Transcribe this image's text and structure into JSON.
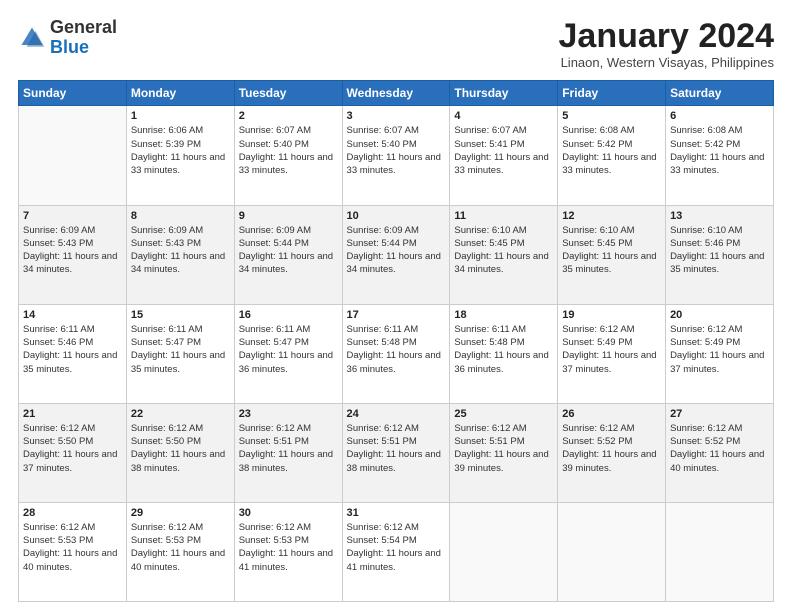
{
  "header": {
    "logo_general": "General",
    "logo_blue": "Blue",
    "month_title": "January 2024",
    "location": "Linaon, Western Visayas, Philippines"
  },
  "weekdays": [
    "Sunday",
    "Monday",
    "Tuesday",
    "Wednesday",
    "Thursday",
    "Friday",
    "Saturday"
  ],
  "weeks": [
    [
      {
        "day": "",
        "sunrise": "",
        "sunset": "",
        "daylight": ""
      },
      {
        "day": "1",
        "sunrise": "Sunrise: 6:06 AM",
        "sunset": "Sunset: 5:39 PM",
        "daylight": "Daylight: 11 hours and 33 minutes."
      },
      {
        "day": "2",
        "sunrise": "Sunrise: 6:07 AM",
        "sunset": "Sunset: 5:40 PM",
        "daylight": "Daylight: 11 hours and 33 minutes."
      },
      {
        "day": "3",
        "sunrise": "Sunrise: 6:07 AM",
        "sunset": "Sunset: 5:40 PM",
        "daylight": "Daylight: 11 hours and 33 minutes."
      },
      {
        "day": "4",
        "sunrise": "Sunrise: 6:07 AM",
        "sunset": "Sunset: 5:41 PM",
        "daylight": "Daylight: 11 hours and 33 minutes."
      },
      {
        "day": "5",
        "sunrise": "Sunrise: 6:08 AM",
        "sunset": "Sunset: 5:42 PM",
        "daylight": "Daylight: 11 hours and 33 minutes."
      },
      {
        "day": "6",
        "sunrise": "Sunrise: 6:08 AM",
        "sunset": "Sunset: 5:42 PM",
        "daylight": "Daylight: 11 hours and 33 minutes."
      }
    ],
    [
      {
        "day": "7",
        "sunrise": "Sunrise: 6:09 AM",
        "sunset": "Sunset: 5:43 PM",
        "daylight": "Daylight: 11 hours and 34 minutes."
      },
      {
        "day": "8",
        "sunrise": "Sunrise: 6:09 AM",
        "sunset": "Sunset: 5:43 PM",
        "daylight": "Daylight: 11 hours and 34 minutes."
      },
      {
        "day": "9",
        "sunrise": "Sunrise: 6:09 AM",
        "sunset": "Sunset: 5:44 PM",
        "daylight": "Daylight: 11 hours and 34 minutes."
      },
      {
        "day": "10",
        "sunrise": "Sunrise: 6:09 AM",
        "sunset": "Sunset: 5:44 PM",
        "daylight": "Daylight: 11 hours and 34 minutes."
      },
      {
        "day": "11",
        "sunrise": "Sunrise: 6:10 AM",
        "sunset": "Sunset: 5:45 PM",
        "daylight": "Daylight: 11 hours and 34 minutes."
      },
      {
        "day": "12",
        "sunrise": "Sunrise: 6:10 AM",
        "sunset": "Sunset: 5:45 PM",
        "daylight": "Daylight: 11 hours and 35 minutes."
      },
      {
        "day": "13",
        "sunrise": "Sunrise: 6:10 AM",
        "sunset": "Sunset: 5:46 PM",
        "daylight": "Daylight: 11 hours and 35 minutes."
      }
    ],
    [
      {
        "day": "14",
        "sunrise": "Sunrise: 6:11 AM",
        "sunset": "Sunset: 5:46 PM",
        "daylight": "Daylight: 11 hours and 35 minutes."
      },
      {
        "day": "15",
        "sunrise": "Sunrise: 6:11 AM",
        "sunset": "Sunset: 5:47 PM",
        "daylight": "Daylight: 11 hours and 35 minutes."
      },
      {
        "day": "16",
        "sunrise": "Sunrise: 6:11 AM",
        "sunset": "Sunset: 5:47 PM",
        "daylight": "Daylight: 11 hours and 36 minutes."
      },
      {
        "day": "17",
        "sunrise": "Sunrise: 6:11 AM",
        "sunset": "Sunset: 5:48 PM",
        "daylight": "Daylight: 11 hours and 36 minutes."
      },
      {
        "day": "18",
        "sunrise": "Sunrise: 6:11 AM",
        "sunset": "Sunset: 5:48 PM",
        "daylight": "Daylight: 11 hours and 36 minutes."
      },
      {
        "day": "19",
        "sunrise": "Sunrise: 6:12 AM",
        "sunset": "Sunset: 5:49 PM",
        "daylight": "Daylight: 11 hours and 37 minutes."
      },
      {
        "day": "20",
        "sunrise": "Sunrise: 6:12 AM",
        "sunset": "Sunset: 5:49 PM",
        "daylight": "Daylight: 11 hours and 37 minutes."
      }
    ],
    [
      {
        "day": "21",
        "sunrise": "Sunrise: 6:12 AM",
        "sunset": "Sunset: 5:50 PM",
        "daylight": "Daylight: 11 hours and 37 minutes."
      },
      {
        "day": "22",
        "sunrise": "Sunrise: 6:12 AM",
        "sunset": "Sunset: 5:50 PM",
        "daylight": "Daylight: 11 hours and 38 minutes."
      },
      {
        "day": "23",
        "sunrise": "Sunrise: 6:12 AM",
        "sunset": "Sunset: 5:51 PM",
        "daylight": "Daylight: 11 hours and 38 minutes."
      },
      {
        "day": "24",
        "sunrise": "Sunrise: 6:12 AM",
        "sunset": "Sunset: 5:51 PM",
        "daylight": "Daylight: 11 hours and 38 minutes."
      },
      {
        "day": "25",
        "sunrise": "Sunrise: 6:12 AM",
        "sunset": "Sunset: 5:51 PM",
        "daylight": "Daylight: 11 hours and 39 minutes."
      },
      {
        "day": "26",
        "sunrise": "Sunrise: 6:12 AM",
        "sunset": "Sunset: 5:52 PM",
        "daylight": "Daylight: 11 hours and 39 minutes."
      },
      {
        "day": "27",
        "sunrise": "Sunrise: 6:12 AM",
        "sunset": "Sunset: 5:52 PM",
        "daylight": "Daylight: 11 hours and 40 minutes."
      }
    ],
    [
      {
        "day": "28",
        "sunrise": "Sunrise: 6:12 AM",
        "sunset": "Sunset: 5:53 PM",
        "daylight": "Daylight: 11 hours and 40 minutes."
      },
      {
        "day": "29",
        "sunrise": "Sunrise: 6:12 AM",
        "sunset": "Sunset: 5:53 PM",
        "daylight": "Daylight: 11 hours and 40 minutes."
      },
      {
        "day": "30",
        "sunrise": "Sunrise: 6:12 AM",
        "sunset": "Sunset: 5:53 PM",
        "daylight": "Daylight: 11 hours and 41 minutes."
      },
      {
        "day": "31",
        "sunrise": "Sunrise: 6:12 AM",
        "sunset": "Sunset: 5:54 PM",
        "daylight": "Daylight: 11 hours and 41 minutes."
      },
      {
        "day": "",
        "sunrise": "",
        "sunset": "",
        "daylight": ""
      },
      {
        "day": "",
        "sunrise": "",
        "sunset": "",
        "daylight": ""
      },
      {
        "day": "",
        "sunrise": "",
        "sunset": "",
        "daylight": ""
      }
    ]
  ]
}
